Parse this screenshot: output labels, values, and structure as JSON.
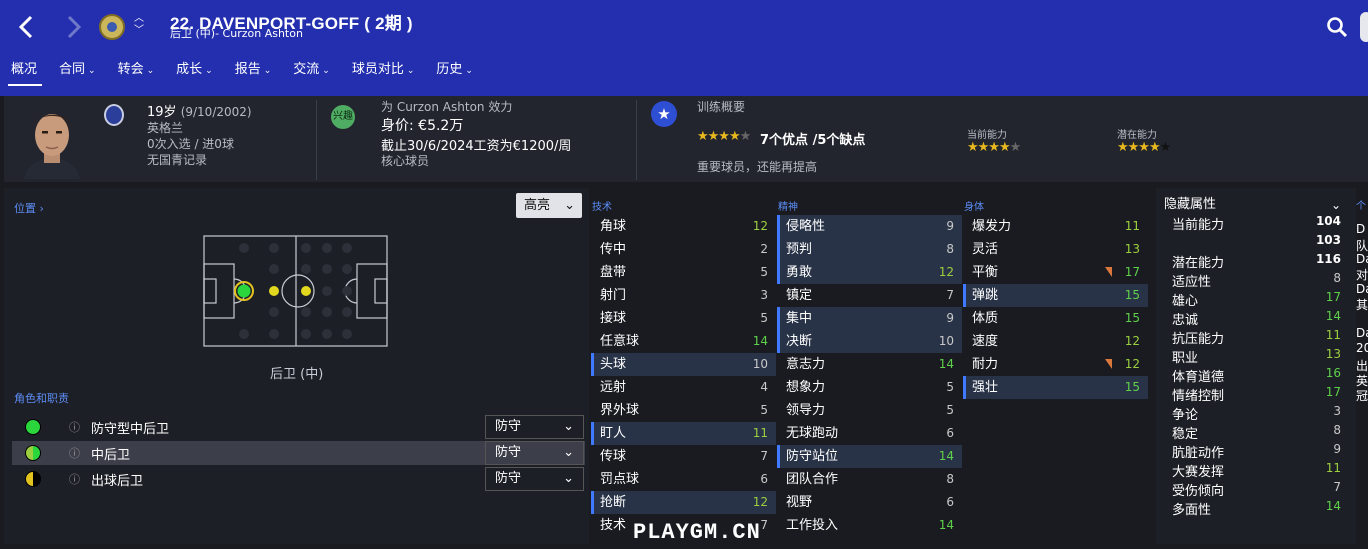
{
  "header": {
    "title": "22. DAVENPORT-GOFF ( 2期 )",
    "subtitle": "后卫 (中)- Curzon Ashton"
  },
  "tabs": [
    {
      "label": "概况",
      "caret": ""
    },
    {
      "label": "合同",
      "caret": "⌄"
    },
    {
      "label": "转会",
      "caret": "⌄"
    },
    {
      "label": "成长",
      "caret": "⌄"
    },
    {
      "label": "报告",
      "caret": "⌄"
    },
    {
      "label": "交流",
      "caret": "⌄"
    },
    {
      "label": "球员对比",
      "caret": "⌄"
    },
    {
      "label": "历史",
      "caret": "⌄"
    }
  ],
  "info": {
    "age": "19岁",
    "dob": "(9/10/2002)",
    "nation": "英格兰",
    "caps": "0次入选 / 进0球",
    "youth": "无国青记录",
    "plays_for": "为 Curzon Ashton 效力",
    "value": "身价: €5.2万",
    "contract": "截止30/6/2024工资为€1200/周",
    "status": "核心球员",
    "interest_badge": "兴趣",
    "training_title": "训练概要",
    "pros_cons": "7个优点 /5个缺点",
    "summary": "重要球员，还能再提高",
    "current_label": "当前能力",
    "potential_label": "潜在能力",
    "pros_stars": 4,
    "current_stars": 4,
    "potential_stars": 4
  },
  "left_panel": {
    "position_link": "位置 ›",
    "highlight": "高亮",
    "position": "后卫 (中)",
    "roles_title": "角色和职责",
    "roles": [
      {
        "name": "防守型中后卫",
        "duty": "防守",
        "color": "#2bd63d"
      },
      {
        "name": "中后卫",
        "duty": "防守",
        "color": "#9ccf3f"
      },
      {
        "name": "出球后卫",
        "duty": "防守",
        "color": "#e2c21f"
      }
    ]
  },
  "categories": {
    "technical": "技术",
    "mental": "精神",
    "physical": "身体"
  },
  "technical": [
    {
      "name": "角球",
      "value": 12,
      "hl": false
    },
    {
      "name": "传中",
      "value": 2,
      "hl": false
    },
    {
      "name": "盘带",
      "value": 5,
      "hl": false
    },
    {
      "name": "射门",
      "value": 3,
      "hl": false
    },
    {
      "name": "接球",
      "value": 5,
      "hl": false
    },
    {
      "name": "任意球",
      "value": 14,
      "hl": false
    },
    {
      "name": "头球",
      "value": 10,
      "hl": true
    },
    {
      "name": "远射",
      "value": 4,
      "hl": false
    },
    {
      "name": "界外球",
      "value": 5,
      "hl": false
    },
    {
      "name": "盯人",
      "value": 11,
      "hl": true
    },
    {
      "name": "传球",
      "value": 7,
      "hl": false
    },
    {
      "name": "罚点球",
      "value": 6,
      "hl": false
    },
    {
      "name": "抢断",
      "value": 12,
      "hl": true
    },
    {
      "name": "技术",
      "value": 7,
      "hl": false
    }
  ],
  "mental": [
    {
      "name": "侵略性",
      "value": 9,
      "hl": true
    },
    {
      "name": "预判",
      "value": 8,
      "hl": true
    },
    {
      "name": "勇敢",
      "value": 12,
      "hl": true
    },
    {
      "name": "镇定",
      "value": 7,
      "hl": false
    },
    {
      "name": "集中",
      "value": 9,
      "hl": true
    },
    {
      "name": "决断",
      "value": 10,
      "hl": true
    },
    {
      "name": "意志力",
      "value": 14,
      "hl": false
    },
    {
      "name": "想象力",
      "value": 5,
      "hl": false
    },
    {
      "name": "领导力",
      "value": 5,
      "hl": false
    },
    {
      "name": "无球跑动",
      "value": 6,
      "hl": false
    },
    {
      "name": "防守站位",
      "value": 14,
      "hl": true
    },
    {
      "name": "团队合作",
      "value": 8,
      "hl": false
    },
    {
      "name": "视野",
      "value": 6,
      "hl": false
    },
    {
      "name": "工作投入",
      "value": 14,
      "hl": false
    }
  ],
  "physical": [
    {
      "name": "爆发力",
      "value": 11,
      "hl": false,
      "drop": false
    },
    {
      "name": "灵活",
      "value": 13,
      "hl": false,
      "drop": false
    },
    {
      "name": "平衡",
      "value": 17,
      "hl": false,
      "drop": true
    },
    {
      "name": "弹跳",
      "value": 15,
      "hl": true,
      "drop": false
    },
    {
      "name": "体质",
      "value": 15,
      "hl": false,
      "drop": false
    },
    {
      "name": "速度",
      "value": 12,
      "hl": false,
      "drop": false
    },
    {
      "name": "耐力",
      "value": 12,
      "hl": false,
      "drop": true
    },
    {
      "name": "强壮",
      "value": 15,
      "hl": true,
      "drop": false
    }
  ],
  "hidden": {
    "title": "隐藏属性",
    "rows": [
      {
        "name": "当前能力",
        "value": "104",
        "style": "b"
      },
      {
        "name": "",
        "value": "103",
        "style": "b"
      },
      {
        "name": "潜在能力",
        "value": "116",
        "style": "b"
      },
      {
        "name": "适应性",
        "value": "8",
        "style": ""
      },
      {
        "name": "雄心",
        "value": "17",
        "style": "g"
      },
      {
        "name": "忠诚",
        "value": "14",
        "style": "g"
      },
      {
        "name": "抗压能力",
        "value": "11",
        "style": "lg"
      },
      {
        "name": "职业",
        "value": "13",
        "style": "lg"
      },
      {
        "name": "体育道德",
        "value": "16",
        "style": "g"
      },
      {
        "name": "情绪控制",
        "value": "17",
        "style": "g"
      },
      {
        "name": "争论",
        "value": "3",
        "style": ""
      },
      {
        "name": "稳定",
        "value": "8",
        "style": ""
      },
      {
        "name": "肮脏动作",
        "value": "9",
        "style": ""
      },
      {
        "name": "大赛发挥",
        "value": "11",
        "style": "lg"
      },
      {
        "name": "受伤倾向",
        "value": "7",
        "style": ""
      },
      {
        "name": "多面性",
        "value": "14",
        "style": "g"
      }
    ]
  },
  "cutoff_column": [
    "个",
    "D",
    "队",
    "Da",
    "对",
    "Da",
    "其",
    "",
    "Da",
    "20",
    "出",
    "英",
    "冠"
  ],
  "watermark": "PLAYGM.CN"
}
